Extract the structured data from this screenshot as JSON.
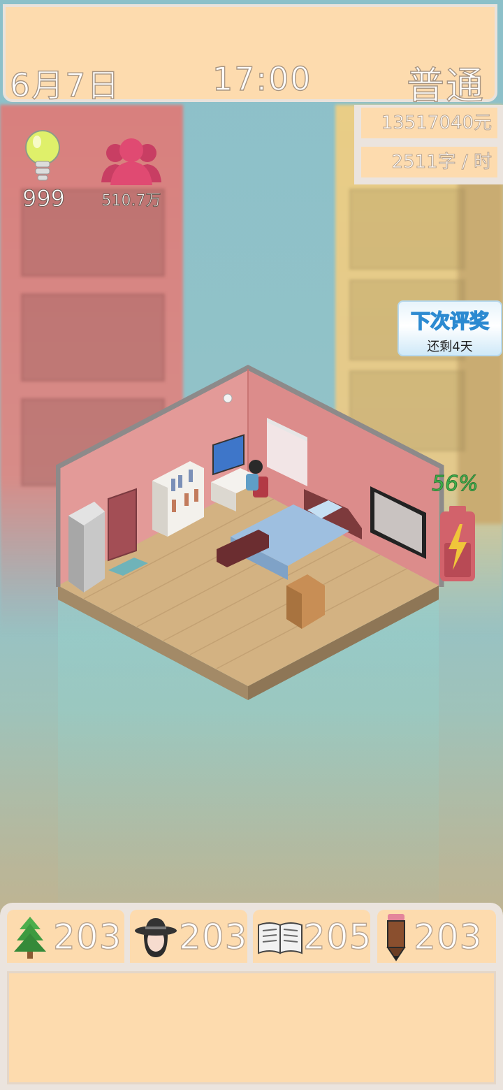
{
  "header": {
    "date": "6月7日",
    "time": "17:00",
    "difficulty": "普通"
  },
  "stats": {
    "money": "13517040元",
    "speed": "2511字 / 时"
  },
  "inspiration": {
    "icon": "lightbulb-icon",
    "value": "999"
  },
  "fans": {
    "icon": "people-icon",
    "value": "510.7万"
  },
  "award": {
    "title": "下次评奖",
    "subtitle": "还剩4天"
  },
  "energy": {
    "percent_label": "56%",
    "level": 0.56,
    "icon": "battery-bolt-icon"
  },
  "attributes": [
    {
      "name": "tree-icon",
      "value": "203"
    },
    {
      "name": "person-hat-icon",
      "value": "203"
    },
    {
      "name": "book-icon",
      "value": "205"
    },
    {
      "name": "pencil-icon",
      "value": "203"
    }
  ],
  "colors": {
    "panel": "#fddbae",
    "frame": "#ebe4de",
    "fans": "#e04a72",
    "energy": "#3fb24a"
  }
}
